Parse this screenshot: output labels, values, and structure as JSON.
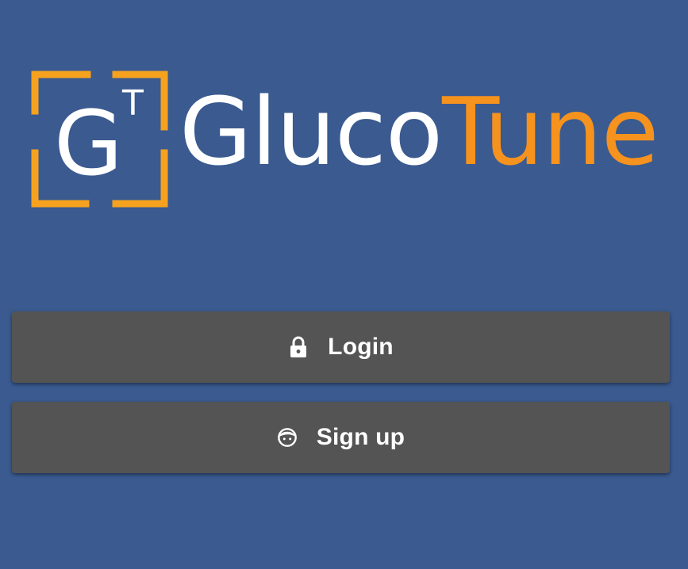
{
  "app": {
    "logo": {
      "monogram_main": "G",
      "monogram_super": "T",
      "wordmark_primary": "Gluco",
      "wordmark_accent": "Tune",
      "colors": {
        "primary": "#ffffff",
        "accent": "#f6921e",
        "frame": "#f6a21e"
      }
    },
    "background_color": "#3a5a90"
  },
  "actions": {
    "login": {
      "label": "Login",
      "icon": "lock-icon"
    },
    "signup": {
      "label": "Sign up",
      "icon": "face-icon"
    },
    "button_color": "#545454"
  }
}
